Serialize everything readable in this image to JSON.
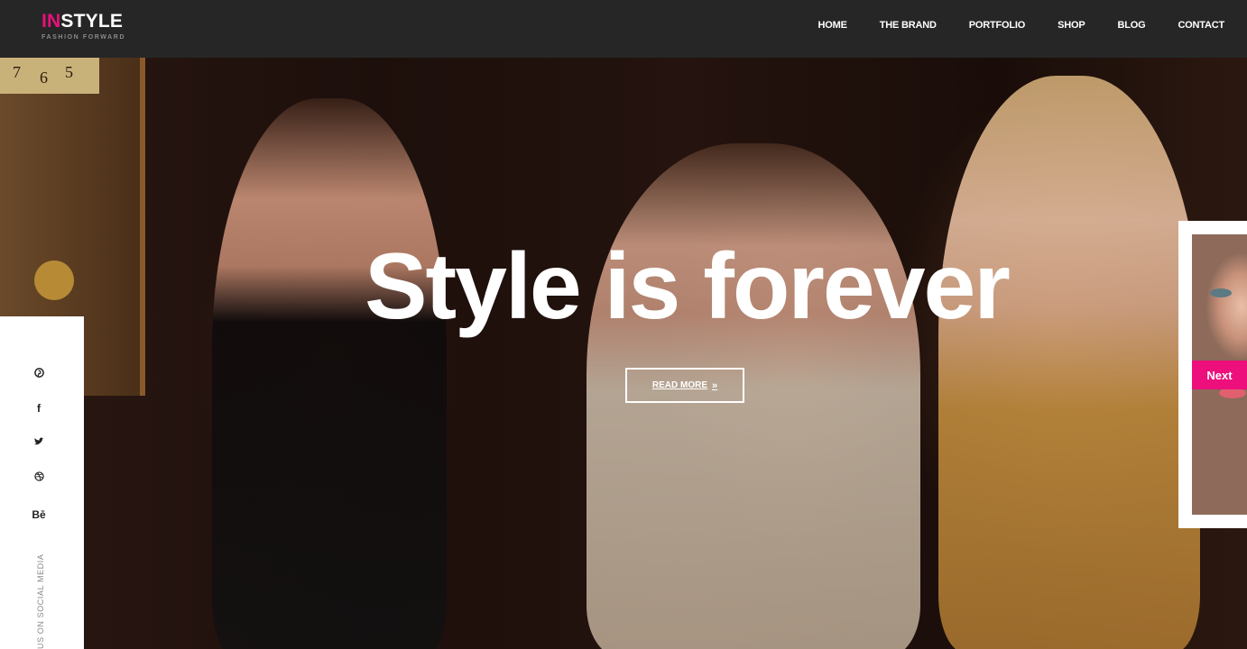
{
  "brand": {
    "accent": "IN",
    "rest": "STYLE",
    "tagline": "FASHION FORWARD",
    "accent_color": "#e8107a"
  },
  "nav": [
    "HOME",
    "THE BRAND",
    "PORTFOLIO",
    "SHOP",
    "BLOG",
    "CONTACT"
  ],
  "hero": {
    "title": "Style is forever",
    "cta": "READ MORE",
    "cta_icon": "double-chevron-right-icon"
  },
  "clock_numbers": [
    "7",
    "6",
    "5"
  ],
  "social": {
    "icons": [
      {
        "name": "pinterest-icon",
        "glyph": "⓿"
      },
      {
        "name": "facebook-icon",
        "glyph": "f"
      },
      {
        "name": "twitter-icon",
        "glyph": "🐦"
      },
      {
        "name": "dribbble-icon",
        "glyph": "⊛"
      },
      {
        "name": "behance-icon",
        "glyph": "Bē"
      }
    ],
    "caption": "US ON SOCIAL MEDIA"
  },
  "next": {
    "label": "Next",
    "color": "#ec0f7c"
  }
}
